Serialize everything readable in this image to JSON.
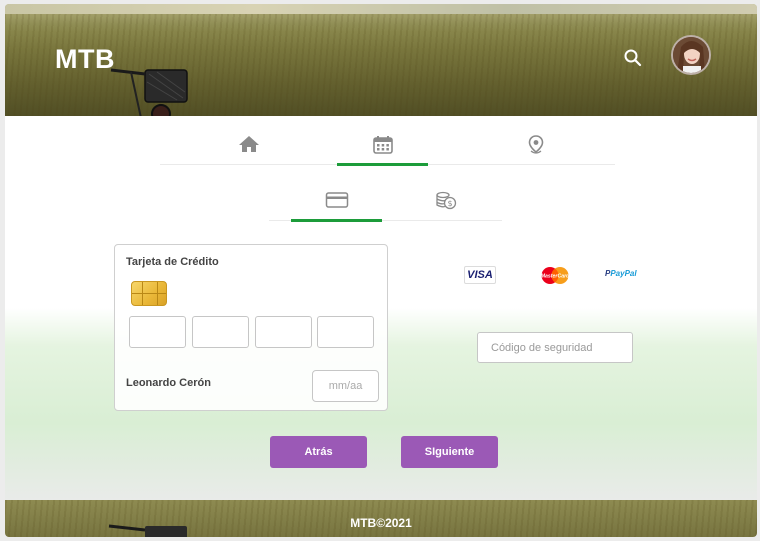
{
  "header": {
    "logo": "MTB"
  },
  "nav": {
    "items": [
      "home-icon",
      "calendar-icon",
      "location-pin-icon"
    ],
    "active": 1
  },
  "payment_tabs": {
    "items": [
      "credit-card-icon",
      "cash-coins-icon"
    ],
    "active": 0
  },
  "card": {
    "title": "Tarjeta de Crédito",
    "holder_name": "Leonardo Cerón",
    "expiry_placeholder": "mm/aa",
    "number_fields": [
      "",
      "",
      "",
      ""
    ]
  },
  "logos": {
    "visa": "VISA",
    "mastercard": "MasterCard",
    "paypal": "PayPal"
  },
  "security": {
    "placeholder": "Código de seguridad"
  },
  "buttons": {
    "back": "Atrás",
    "next": "SIguiente"
  },
  "footer": {
    "text": "MTB©2021"
  },
  "colors": {
    "accent_green": "#1c9c3a",
    "button_purple": "#9b59b6",
    "icon_gray": "#8a8a8a"
  }
}
